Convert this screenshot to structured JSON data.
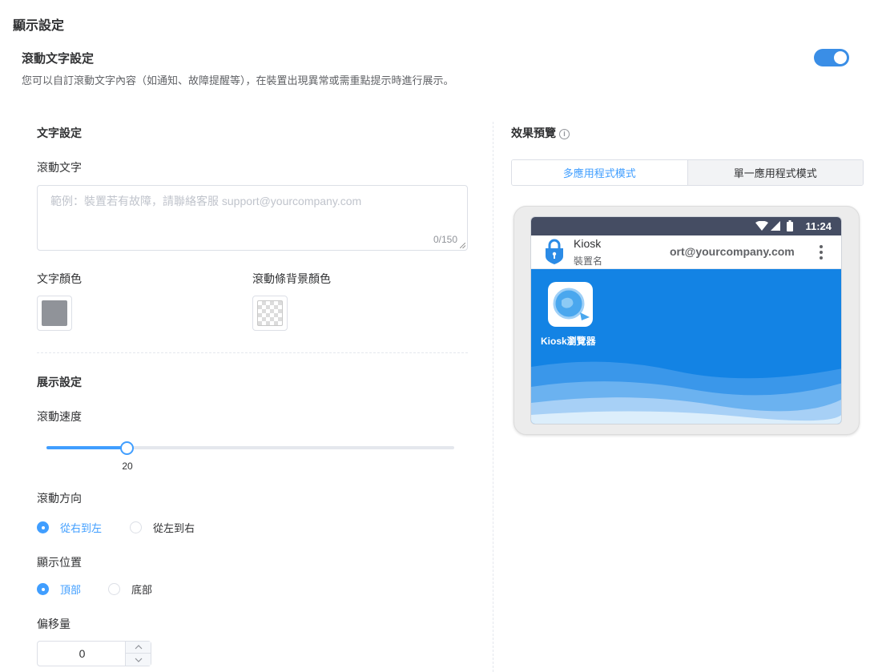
{
  "page": {
    "title": "顯示設定"
  },
  "scroll_text": {
    "title": "滾動文字設定",
    "description": "您可以自訂滾動文字內容（如通知、故障提醒等），在裝置出現異常或需重點提示時進行展示。",
    "enabled": true
  },
  "text_settings": {
    "heading": "文字設定",
    "text_label": "滾動文字",
    "text_placeholder": "範例：裝置若有故障，請聯絡客服 support@yourcompany.com",
    "text_value": "",
    "char_count": "0/150",
    "text_color_label": "文字顏色",
    "text_color": "#909399",
    "bg_color_label": "滾動條背景顏色",
    "bg_color": "transparent"
  },
  "display_settings": {
    "heading": "展示設定",
    "speed_label": "滾動速度",
    "speed_value": "20",
    "speed_fraction": 0.2,
    "direction_label": "滾動方向",
    "direction_options": [
      "從右到左",
      "從左到右"
    ],
    "direction_selected": "從右到左",
    "position_label": "顯示位置",
    "position_options": [
      "頂部",
      "底部"
    ],
    "position_selected": "頂部",
    "offset_label": "偏移量",
    "offset_value": "0"
  },
  "preview": {
    "heading": "效果預覽",
    "info_icon": "i",
    "tabs": [
      "多應用程式模式",
      "單一應用程式模式"
    ],
    "active_tab": "多應用程式模式",
    "status_time": "11:24",
    "app_name": "Kiosk",
    "device_name": "裝置名",
    "scroll_text": "ort@yourcompany.com",
    "app_icon_label": "Kiosk瀏覽器"
  },
  "colors": {
    "accent": "#409eff",
    "toggle": "#3a8ee6",
    "wallpaper": "#1383e4",
    "statusbar": "#454d63"
  }
}
